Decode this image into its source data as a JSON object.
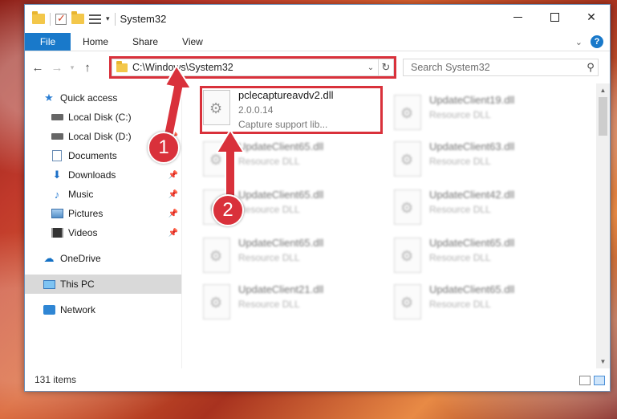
{
  "window": {
    "title": "System32"
  },
  "ribbon": {
    "tabs": [
      "File",
      "Home",
      "Share",
      "View"
    ]
  },
  "address": {
    "path": "C:\\Windows\\System32"
  },
  "search": {
    "placeholder": "Search System32"
  },
  "nav": {
    "items": [
      {
        "label": "Quick access",
        "icon": "star-icon",
        "pinned": false
      },
      {
        "label": "Local Disk (C:)",
        "icon": "disk-icon",
        "pinned": true
      },
      {
        "label": "Local Disk (D:)",
        "icon": "disk-icon",
        "pinned": true
      },
      {
        "label": "Documents",
        "icon": "document-icon",
        "pinned": true
      },
      {
        "label": "Downloads",
        "icon": "download-icon",
        "pinned": true
      },
      {
        "label": "Music",
        "icon": "music-icon",
        "pinned": true
      },
      {
        "label": "Pictures",
        "icon": "pictures-icon",
        "pinned": true
      },
      {
        "label": "Videos",
        "icon": "videos-icon",
        "pinned": true
      },
      {
        "label": "OneDrive",
        "icon": "cloud-icon"
      },
      {
        "label": "This PC",
        "icon": "computer-icon",
        "selected": true
      },
      {
        "label": "Network",
        "icon": "network-icon"
      }
    ]
  },
  "files": {
    "highlighted": {
      "name": "pclecaptureavdv2.dll",
      "version": "2.0.0.14",
      "description": "Capture support lib..."
    },
    "others": [
      {
        "name": "UpdateClient19.dll",
        "type": "Resource DLL"
      },
      {
        "name": "UpdateClient65.dll",
        "type": "Resource DLL"
      },
      {
        "name": "UpdateClient63.dll",
        "type": "Resource DLL"
      },
      {
        "name": "UpdateClient65.dll",
        "type": "Resource DLL"
      },
      {
        "name": "UpdateClient42.dll",
        "type": "Resource DLL"
      },
      {
        "name": "UpdateClient65.dll",
        "type": "Resource DLL"
      },
      {
        "name": "UpdateClient65.dll",
        "type": "Resource DLL"
      },
      {
        "name": "UpdateClient21.dll",
        "type": "Resource DLL"
      },
      {
        "name": "UpdateClient65.dll",
        "type": "Resource DLL"
      }
    ]
  },
  "status": {
    "count": "131 items"
  },
  "annotations": {
    "badge1": "1",
    "badge2": "2",
    "color": "#d9313b"
  },
  "colors": {
    "accent": "#1979ca"
  }
}
